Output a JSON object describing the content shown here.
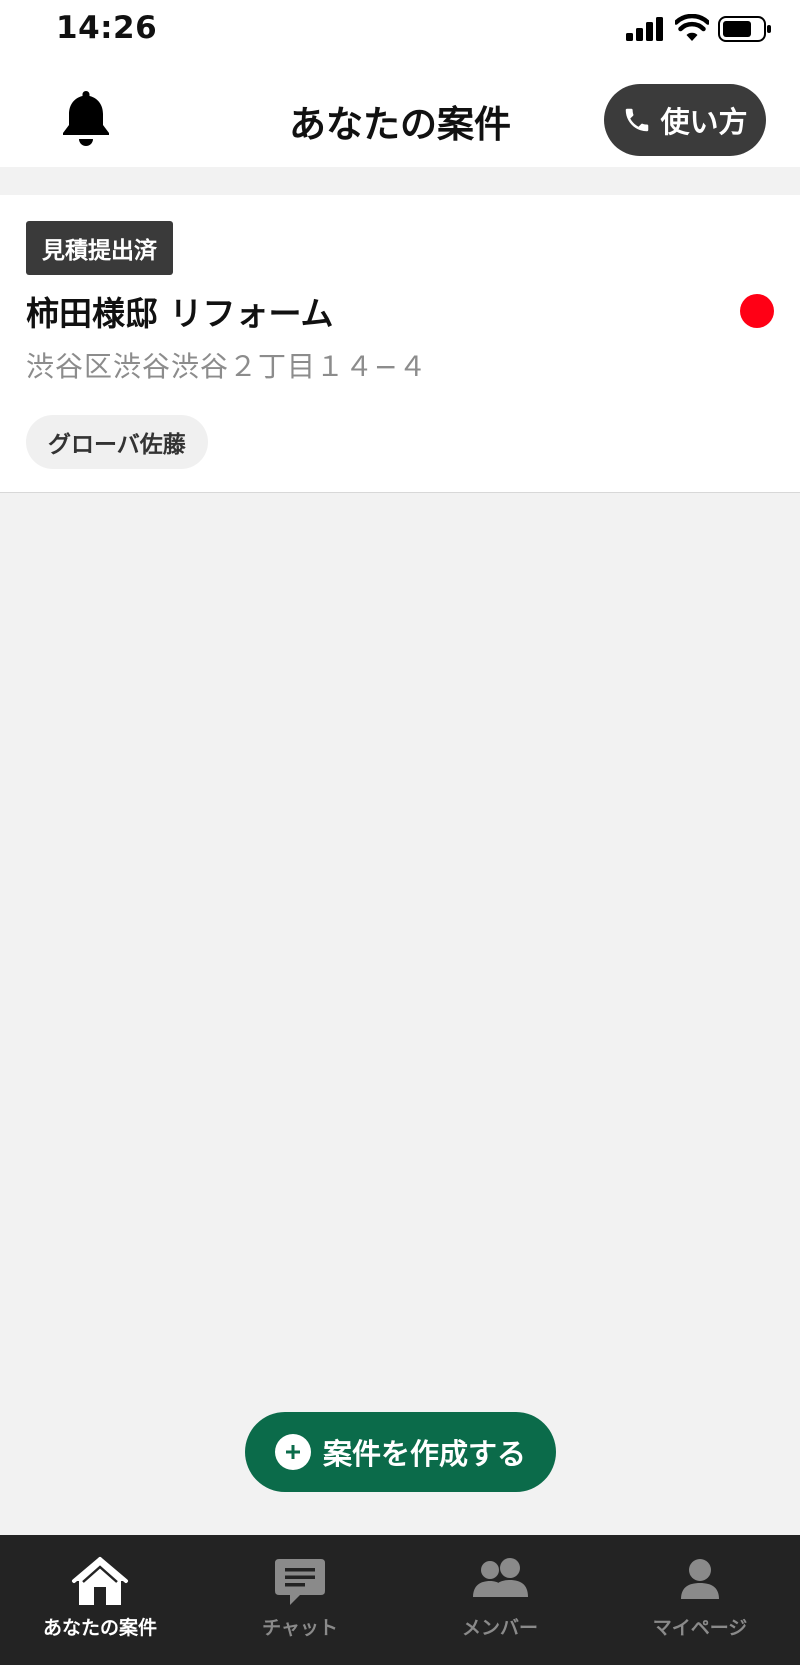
{
  "status_bar": {
    "time": "14:26"
  },
  "header": {
    "title": "あなたの案件",
    "howto_label": "使い方",
    "bell_icon": "bell-icon",
    "phone_icon": "phone-icon"
  },
  "projects": [
    {
      "status": "見積提出済",
      "title": "柿田様邸 リフォーム",
      "address": "渋谷区渋谷渋谷２丁目１４−４",
      "member": "グローバ佐藤",
      "unread": true,
      "unread_color": "#ff0015"
    }
  ],
  "create_button": {
    "label": "案件を作成する",
    "icon": "plus-circle-icon"
  },
  "tabs": [
    {
      "label": "あなたの案件",
      "icon": "home-icon",
      "active": true
    },
    {
      "label": "チャット",
      "icon": "chat-icon",
      "active": false
    },
    {
      "label": "メンバー",
      "icon": "members-icon",
      "active": false
    },
    {
      "label": "マイページ",
      "icon": "person-icon",
      "active": false
    }
  ],
  "colors": {
    "accent": "#0b6b4a",
    "tab_bar": "#232323",
    "badge": "#3a3a3a",
    "unread": "#ff0015"
  }
}
